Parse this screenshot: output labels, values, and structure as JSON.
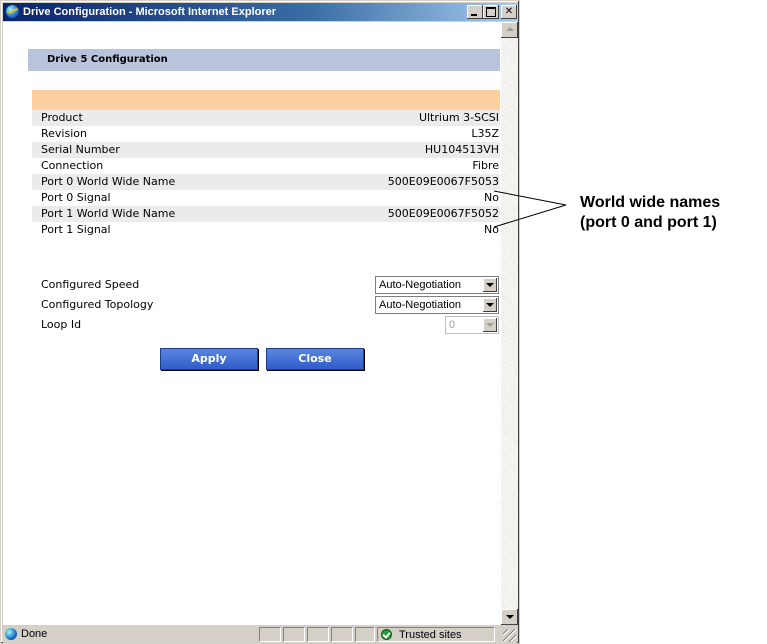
{
  "window": {
    "title": "Drive Configuration - Microsoft Internet Explorer"
  },
  "page": {
    "heading": "Drive 5  Configuration"
  },
  "drive_info": [
    {
      "label": "Product",
      "value": "Ultrium 3-SCSI"
    },
    {
      "label": "Revision",
      "value": "L35Z"
    },
    {
      "label": "Serial Number",
      "value": "HU104513VH"
    },
    {
      "label": "Connection",
      "value": "Fibre"
    },
    {
      "label": "Port 0 World Wide Name",
      "value": "500E09E0067F5053"
    },
    {
      "label": "Port 0 Signal",
      "value": "No"
    },
    {
      "label": "Port 1 World Wide Name",
      "value": "500E09E0067F5052"
    },
    {
      "label": "Port 1 Signal",
      "value": "No"
    }
  ],
  "settings": {
    "speed": {
      "label": "Configured Speed",
      "value": "Auto-Negotiation"
    },
    "topology": {
      "label": "Configured Topology",
      "value": "Auto-Negotiation"
    },
    "loop_id": {
      "label": "Loop Id",
      "value": "0"
    }
  },
  "buttons": {
    "apply": "Apply",
    "close": "Close"
  },
  "statusbar": {
    "status": "Done",
    "zone": "Trusted sites"
  },
  "callout": {
    "line1": "World wide names",
    "line2": "(port 0 and port 1)"
  }
}
